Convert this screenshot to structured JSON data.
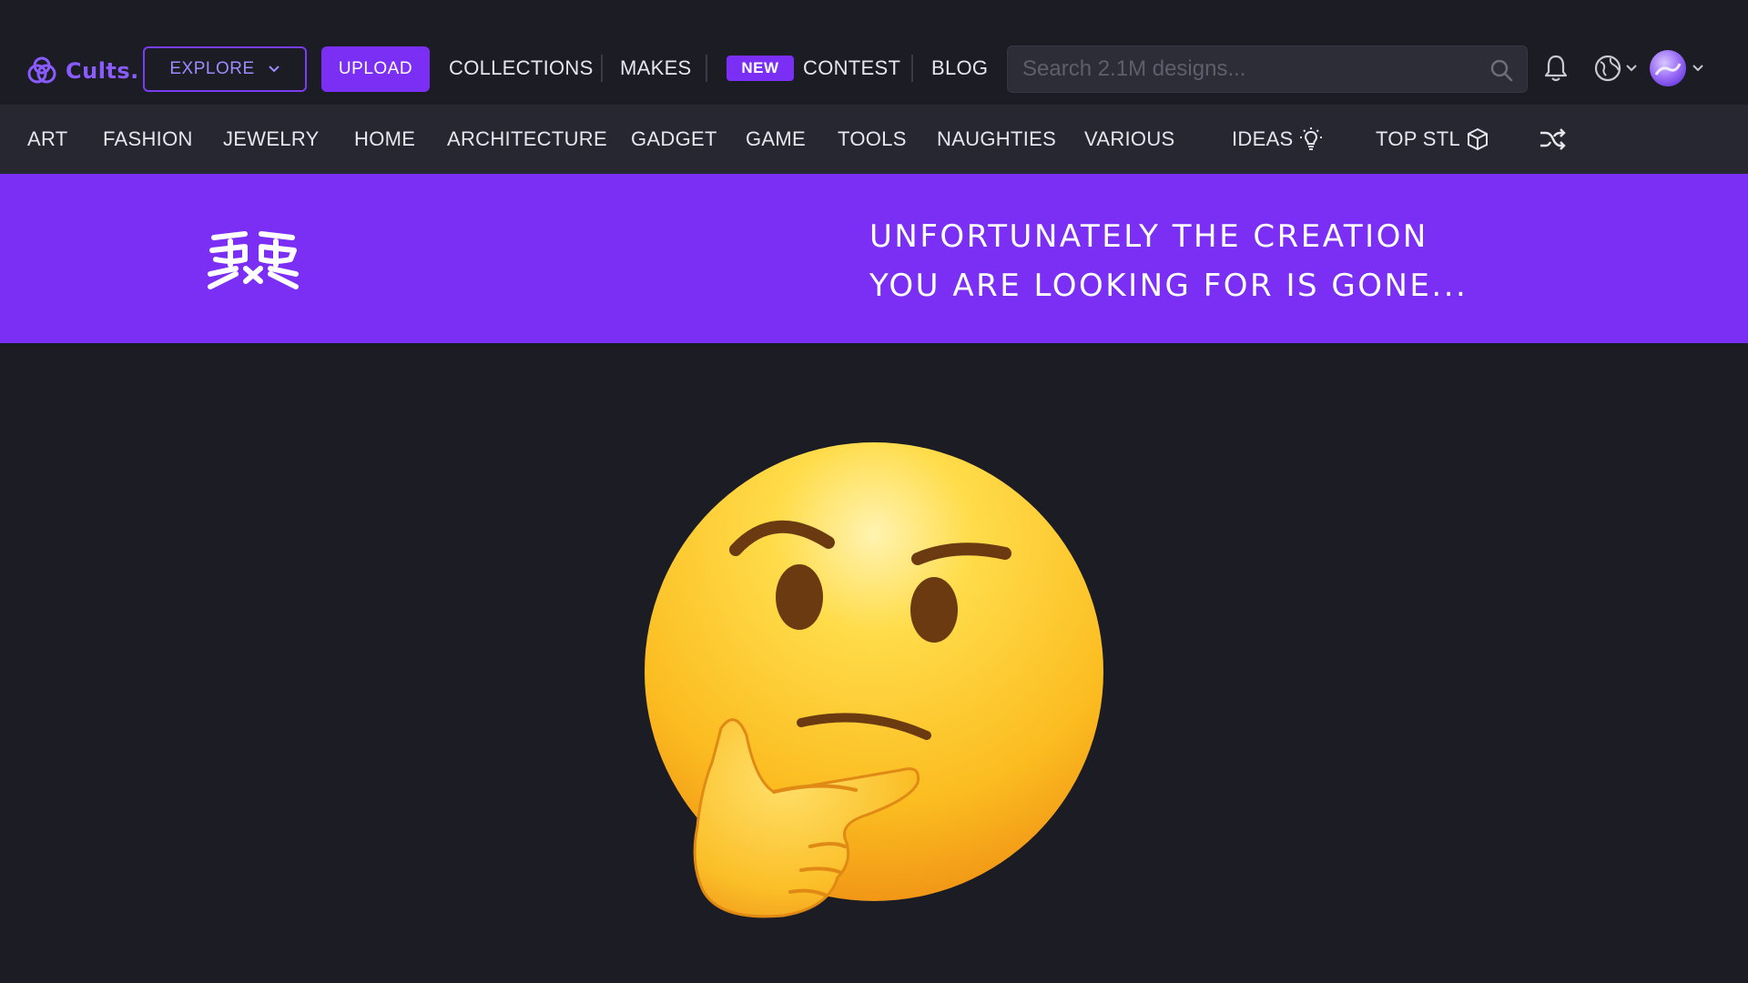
{
  "header": {
    "logo_text": "Cults.",
    "explore_label": "EXPLORE",
    "upload_label": "UPLOAD",
    "links": {
      "collections": "COLLECTIONS",
      "makes": "MAKES",
      "new_badge": "NEW",
      "contest": "CONTEST",
      "blog": "BLOG"
    },
    "search": {
      "placeholder": "Search 2.1M designs...",
      "value": ""
    },
    "icons": [
      "bell-icon",
      "globe-icon",
      "chevron-down-icon",
      "avatar"
    ]
  },
  "categories": {
    "art": "ART",
    "fashion": "FASHION",
    "jewelry": "JEWELRY",
    "home": "HOME",
    "architecture": "ARCHITECTURE",
    "gadget": "GADGET",
    "game": "GAME",
    "tools": "TOOLS",
    "naughties": "NAUGHTIES",
    "various": "VARIOUS",
    "ideas": "IDEAS",
    "top_stl": "TOP STL",
    "random_icon": "shuffle-icon"
  },
  "banner": {
    "line1": "UNFORTUNATELY THE CREATION",
    "line2": "YOU ARE LOOKING FOR IS GONE..."
  },
  "illustration": "thinking-face-emoji",
  "colors": {
    "accent": "#7b2ff5",
    "background": "#1b1c24",
    "category_bar": "#262731",
    "search_bg": "#2c2d36"
  }
}
